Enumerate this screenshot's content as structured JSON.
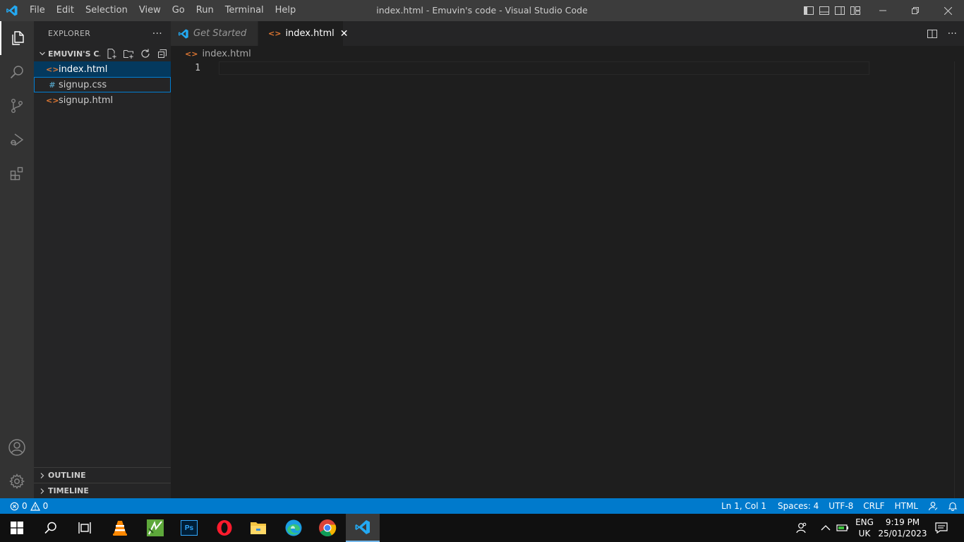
{
  "titlebar": {
    "menu": [
      "File",
      "Edit",
      "Selection",
      "View",
      "Go",
      "Run",
      "Terminal",
      "Help"
    ],
    "window_title": "index.html - Emuvin's code - Visual Studio Code"
  },
  "activitybar": {
    "items": [
      "explorer-icon",
      "search-icon",
      "source-control-icon",
      "run-debug-icon",
      "extensions-icon"
    ],
    "bottom_items": [
      "account-icon",
      "gear-icon"
    ]
  },
  "sidebar": {
    "title": "EXPLORER",
    "more": "···",
    "folder": "EMUVIN'S C...",
    "files": [
      {
        "name": "index.html",
        "icon": "<>",
        "type": "html"
      },
      {
        "name": "signup.css",
        "icon": "#",
        "type": "css"
      },
      {
        "name": "signup.html",
        "icon": "<>",
        "type": "html"
      }
    ],
    "outline": "OUTLINE",
    "timeline": "TIMELINE"
  },
  "tabs": [
    {
      "label": "Get Started",
      "active": false
    },
    {
      "label": "index.html",
      "active": true,
      "icon": "<>",
      "close": "✕"
    }
  ],
  "editor_actions": {
    "more": "···"
  },
  "breadcrumb": {
    "icon": "<>",
    "file": "index.html"
  },
  "editor": {
    "line_numbers": [
      "1"
    ]
  },
  "statusbar": {
    "errors": "0",
    "warnings": "0",
    "position": "Ln 1, Col 1",
    "spaces": "Spaces: 4",
    "encoding": "UTF-8",
    "eol": "CRLF",
    "language": "HTML",
    "accent_color": "#007acc"
  },
  "taskbar": {
    "apps": [
      "windows-start-icon",
      "search-icon",
      "task-view-icon",
      "vlc-icon",
      "camtasia-icon",
      "photoshop-icon",
      "opera-icon",
      "file-explorer-icon",
      "edge-icon",
      "chrome-icon",
      "vscode-icon"
    ],
    "photoshop_label": "Ps",
    "lang_line1": "ENG",
    "lang_line2": "UK",
    "time": "9:19 PM",
    "date": "25/01/2023"
  }
}
